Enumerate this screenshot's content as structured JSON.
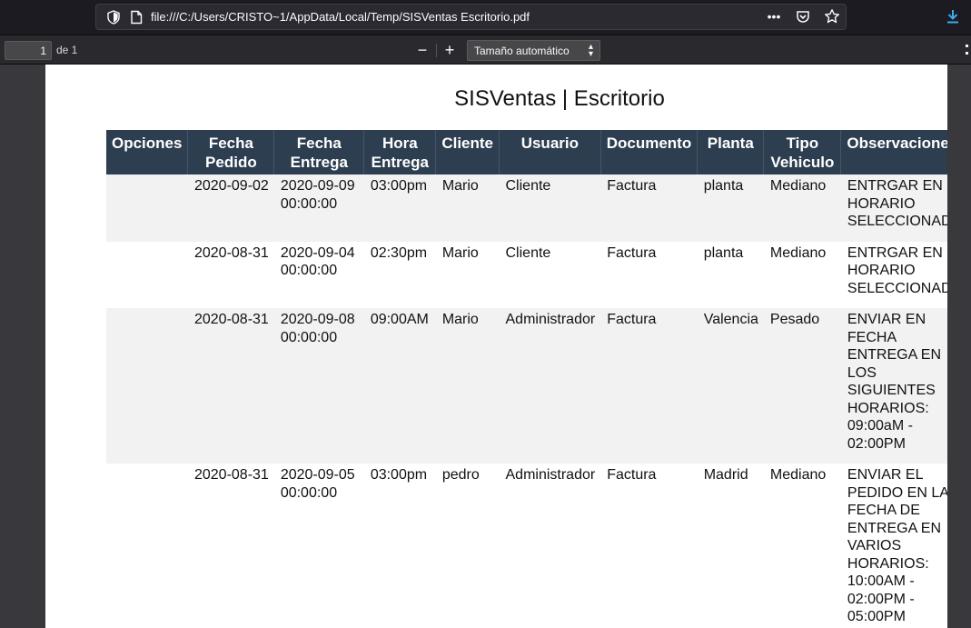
{
  "browser": {
    "url": "file:///C:/Users/CRISTO~1/AppData/Local/Temp/SISVentas Escritorio.pdf",
    "more_label": "•••"
  },
  "pdf_toolbar": {
    "page_number": "1",
    "page_total": "de 1",
    "zoom_out_label": "−",
    "zoom_in_label": "+",
    "zoom_option": "Tamaño automático"
  },
  "document": {
    "title": "SISVentas | Escritorio",
    "headers": [
      "Opciones",
      "Fecha Pedido",
      "Fecha Entrega",
      "Hora Entrega",
      "Cliente",
      "Usuario",
      "Documento",
      "Planta",
      "Tipo Vehiculo",
      "Observaciones"
    ],
    "rows": [
      {
        "opciones": "",
        "fecha_pedido": "2020-09-02",
        "fecha_entrega": "2020-09-09 00:00:00",
        "hora_entrega": "03:00pm",
        "cliente": "Mario",
        "usuario": "Cliente",
        "documento": "Factura",
        "planta": "planta",
        "tipo_vehiculo": "Mediano",
        "observaciones": "ENTRGAR EN HORARIO SELECCIONADO"
      },
      {
        "opciones": "",
        "fecha_pedido": "2020-08-31",
        "fecha_entrega": "2020-09-04 00:00:00",
        "hora_entrega": "02:30pm",
        "cliente": "Mario",
        "usuario": "Cliente",
        "documento": "Factura",
        "planta": "planta",
        "tipo_vehiculo": "Mediano",
        "observaciones": "ENTRGAR EN HORARIO SELECCIONADO"
      },
      {
        "opciones": "",
        "fecha_pedido": "2020-08-31",
        "fecha_entrega": "2020-09-08 00:00:00",
        "hora_entrega": "09:00AM",
        "cliente": "Mario",
        "usuario": "Administrador",
        "documento": "Factura",
        "planta": "Valencia",
        "tipo_vehiculo": "Pesado",
        "observaciones": "ENVIAR EN FECHA ENTREGA EN LOS SIGUIENTES HORARIOS: 09:00aM - 02:00PM"
      },
      {
        "opciones": "",
        "fecha_pedido": "2020-08-31",
        "fecha_entrega": "2020-09-05 00:00:00",
        "hora_entrega": "03:00pm",
        "cliente": "pedro",
        "usuario": "Administrador",
        "documento": "Factura",
        "planta": "Madrid",
        "tipo_vehiculo": "Mediano",
        "observaciones": "ENVIAR EL PEDIDO EN LA FECHA DE ENTREGA EN VARIOS HORARIOS: 10:00AM - 02:00PM - 05:00PM"
      }
    ]
  },
  "icons": [
    "shield-icon",
    "page-icon",
    "more-icon",
    "pocket-icon",
    "bookmark-star-icon",
    "download-icon",
    "chevron-updown-icon"
  ]
}
